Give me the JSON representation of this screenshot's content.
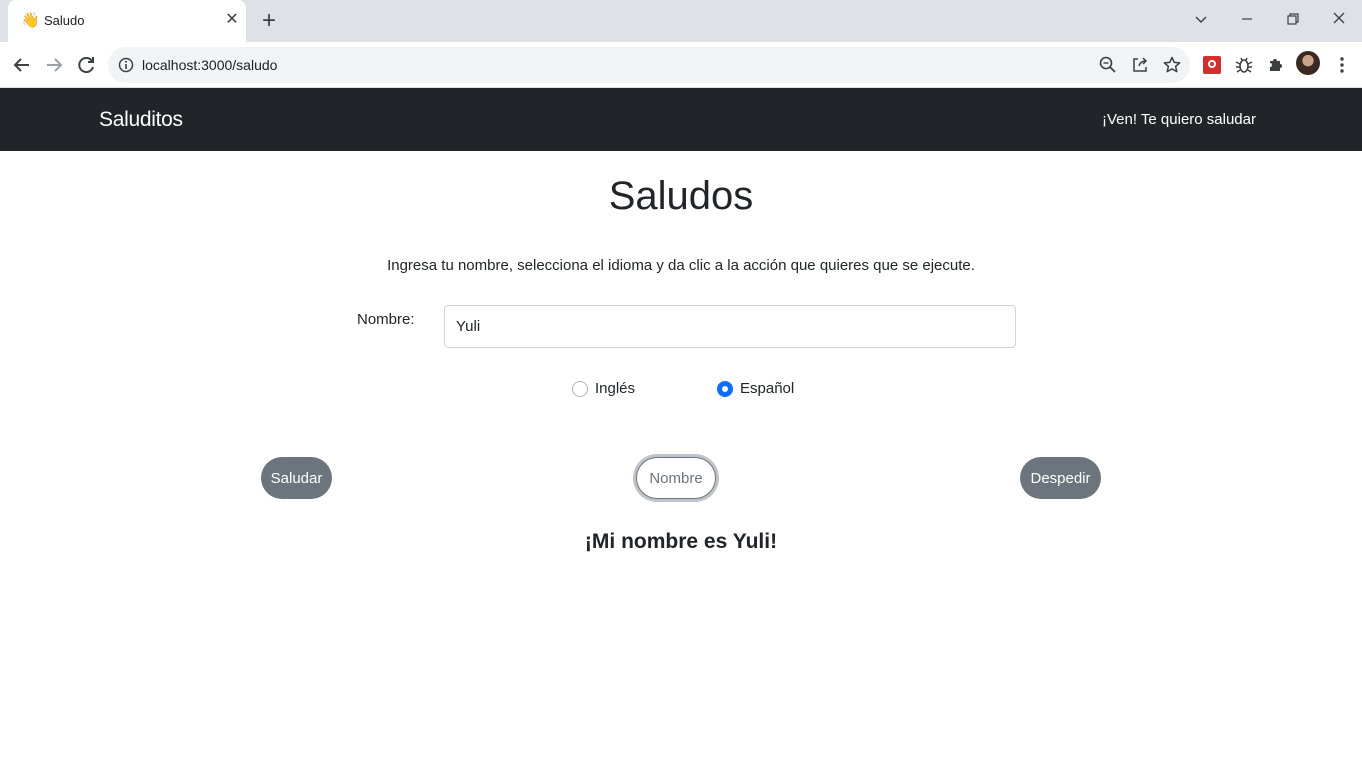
{
  "browser": {
    "tab_title": "Saludo",
    "url": "localhost:3000/saludo"
  },
  "navbar": {
    "brand": "Saluditos",
    "link": "¡Ven! Te quiero saludar"
  },
  "main": {
    "title": "Saludos",
    "instructions": "Ingresa tu nombre, selecciona el idioma y da clic a la acción que quieres que se ejecute.",
    "name_label": "Nombre:",
    "name_value": "Yuli",
    "languages": [
      {
        "label": "Inglés",
        "selected": false
      },
      {
        "label": "Español",
        "selected": true
      }
    ],
    "buttons": {
      "saludar": "Saludar",
      "nombre": "Nombre",
      "despedir": "Despedir"
    },
    "result": "¡Mi nombre es Yuli!"
  },
  "colors": {
    "navbar_bg": "#212529",
    "button_secondary": "#6c757d",
    "radio_accent": "#0d6efd"
  }
}
